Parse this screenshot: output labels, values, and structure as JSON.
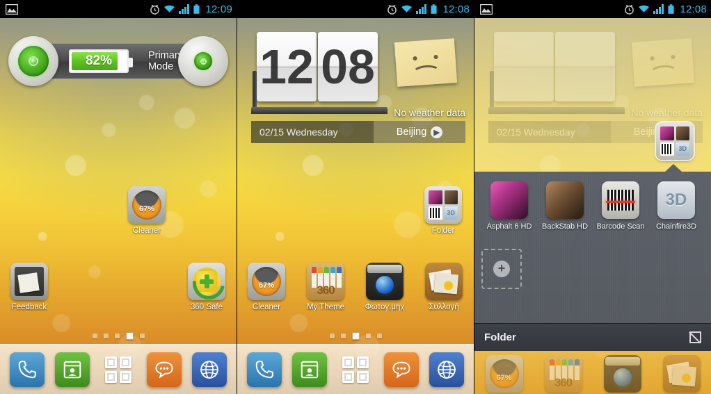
{
  "panels": [
    {
      "id": "home-screen-battery",
      "statusbar": {
        "clock": "12:09",
        "icons": [
          "image-icon",
          "alarm-icon",
          "wifi-icon",
          "signal-icon",
          "battery-icon"
        ],
        "show_image_icon": true
      },
      "battery_widget": {
        "percent_label": "82%",
        "percent_value": 82,
        "mode_label": "Primary Mode"
      },
      "widgets": [
        {
          "name": "cleaner-widget",
          "label": "Cleaner",
          "value_label": "67%"
        }
      ],
      "apps": [
        {
          "name": "feedback",
          "label": "Feedback"
        },
        {
          "name": "360-safe",
          "label": "360 Safe"
        }
      ],
      "page_dots": {
        "count": 5,
        "active_index": 3
      },
      "dock": [
        {
          "name": "phone",
          "glyph": "☎"
        },
        {
          "name": "contacts",
          "glyph": "Ὄ7"
        },
        {
          "name": "app-drawer",
          "glyph": ""
        },
        {
          "name": "messaging",
          "glyph": "●"
        },
        {
          "name": "browser",
          "glyph": "ἱ0"
        }
      ]
    },
    {
      "id": "home-screen-clock",
      "statusbar": {
        "clock": "12:08",
        "icons": [
          "alarm-icon",
          "wifi-icon",
          "signal-icon",
          "battery-icon"
        ],
        "show_image_icon": false
      },
      "clock_widget": {
        "hours": "12",
        "minutes": "08",
        "date": "02/15 Wednesday",
        "city": "Beijing",
        "weather_status": "No weather data",
        "sticky_note": "sad-face-note"
      },
      "folder_icon": {
        "label": "Folder"
      },
      "apps": [
        {
          "name": "cleaner",
          "label": "Cleaner",
          "value_label": "67%"
        },
        {
          "name": "my-theme",
          "label": "My Theme",
          "badge": "360"
        },
        {
          "name": "camera",
          "label": "Φωτογ.μηχ"
        },
        {
          "name": "gallery",
          "label": "Συλλογή"
        }
      ],
      "page_dots": {
        "count": 5,
        "active_index": 2
      },
      "dock": [
        {
          "name": "phone"
        },
        {
          "name": "contacts"
        },
        {
          "name": "app-drawer"
        },
        {
          "name": "messaging"
        },
        {
          "name": "browser"
        }
      ]
    },
    {
      "id": "folder-open",
      "statusbar": {
        "clock": "12:08",
        "icons": [
          "image-icon",
          "alarm-icon",
          "wifi-icon",
          "signal-icon",
          "battery-icon"
        ],
        "show_image_icon": true
      },
      "clock_widget": {
        "date": "02/15 Wednesday",
        "city": "Beijing",
        "weather_status": "No weather data"
      },
      "folder": {
        "title": "Folder",
        "edit_icon": "rename-icon",
        "apps": [
          {
            "name": "asphalt-6-hd",
            "label": "Asphalt 6 HD"
          },
          {
            "name": "backstab-hd",
            "label": "BackStab HD"
          },
          {
            "name": "barcode-scanner",
            "label": "Barcode Scan"
          },
          {
            "name": "chainfire3d",
            "label": "Chainfire3D"
          }
        ],
        "add_slot_label": "+"
      }
    }
  ],
  "colors": {
    "accent_blue": "#3bbbe8",
    "battery_green": "#5cc322",
    "cleaner_orange": "#e8891c",
    "folder_bg": "#5c6068",
    "folder_footer": "#3d4148"
  }
}
